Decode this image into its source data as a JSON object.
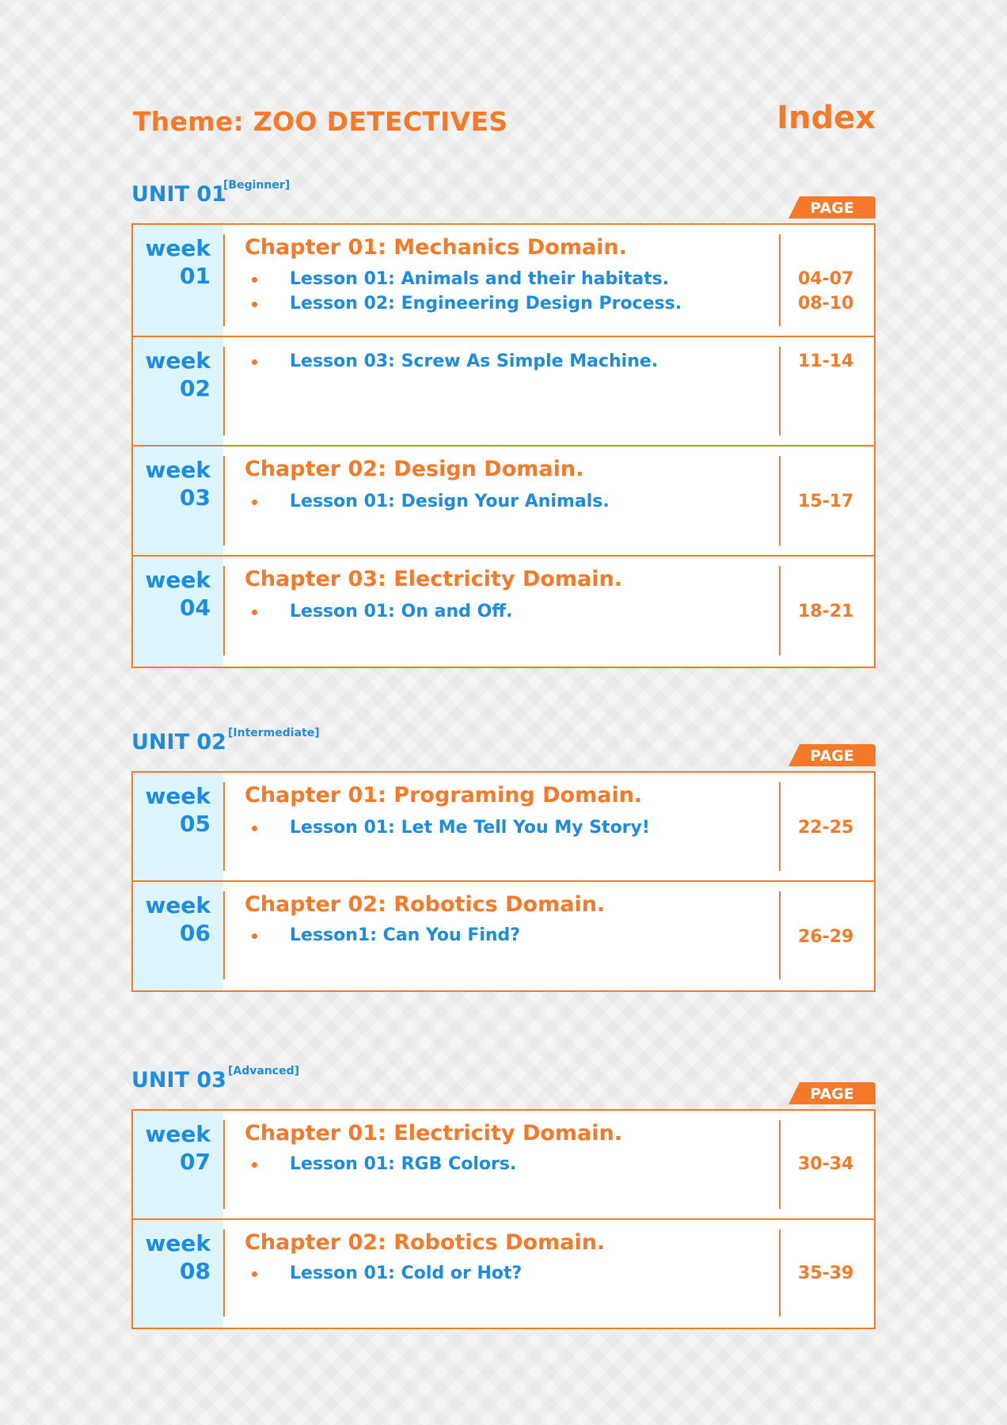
{
  "theme": "Theme: ZOO DETECTIVES",
  "index_title": "Index",
  "page_label": "PAGE",
  "units": [
    {
      "title": "UNIT 01",
      "level": "[Beginner]",
      "weeks": [
        {
          "week": "week",
          "num": "01",
          "chapter": "Chapter 01: Mechanics Domain.",
          "lessons": [
            {
              "text": "Lesson 01: Animals and their habitats.",
              "pages": "04-07"
            },
            {
              "text": "Lesson 02: Engineering Design Process.",
              "pages": "08-10"
            }
          ]
        },
        {
          "week": "week",
          "num": "02",
          "chapter": "",
          "lessons": [
            {
              "text": "Lesson 03: Screw As Simple Machine.",
              "pages": "11-14"
            }
          ]
        },
        {
          "week": "week",
          "num": "03",
          "chapter": "Chapter 02: Design Domain.",
          "lessons": [
            {
              "text": "Lesson 01: Design Your Animals.",
              "pages": "15-17"
            }
          ]
        },
        {
          "week": "week",
          "num": "04",
          "chapter": "Chapter 03: Electricity Domain.",
          "lessons": [
            {
              "text": "Lesson 01: On and Off.",
              "pages": "18-21"
            }
          ]
        }
      ]
    },
    {
      "title": "UNIT 02",
      "level": "[Intermediate]",
      "weeks": [
        {
          "week": "week",
          "num": "05",
          "chapter": "Chapter 01: Programing Domain.",
          "lessons": [
            {
              "text": "Lesson 01: Let Me Tell You My Story!",
              "pages": "22-25"
            }
          ]
        },
        {
          "week": "week",
          "num": "06",
          "chapter": "Chapter 02: Robotics Domain.",
          "lessons": [
            {
              "text": "Lesson1: Can You Find?",
              "pages": "26-29"
            }
          ]
        }
      ]
    },
    {
      "title": "UNIT 03",
      "level": "[Advanced]",
      "weeks": [
        {
          "week": "week",
          "num": "07",
          "chapter": "Chapter 01: Electricity Domain.",
          "lessons": [
            {
              "text": "Lesson 01: RGB Colors.",
              "pages": "30-34"
            }
          ]
        },
        {
          "week": "week",
          "num": "08",
          "chapter": "Chapter 02: Robotics Domain.",
          "lessons": [
            {
              "text": "Lesson 01: Cold or Hot?",
              "pages": "35-39"
            }
          ]
        }
      ]
    }
  ]
}
